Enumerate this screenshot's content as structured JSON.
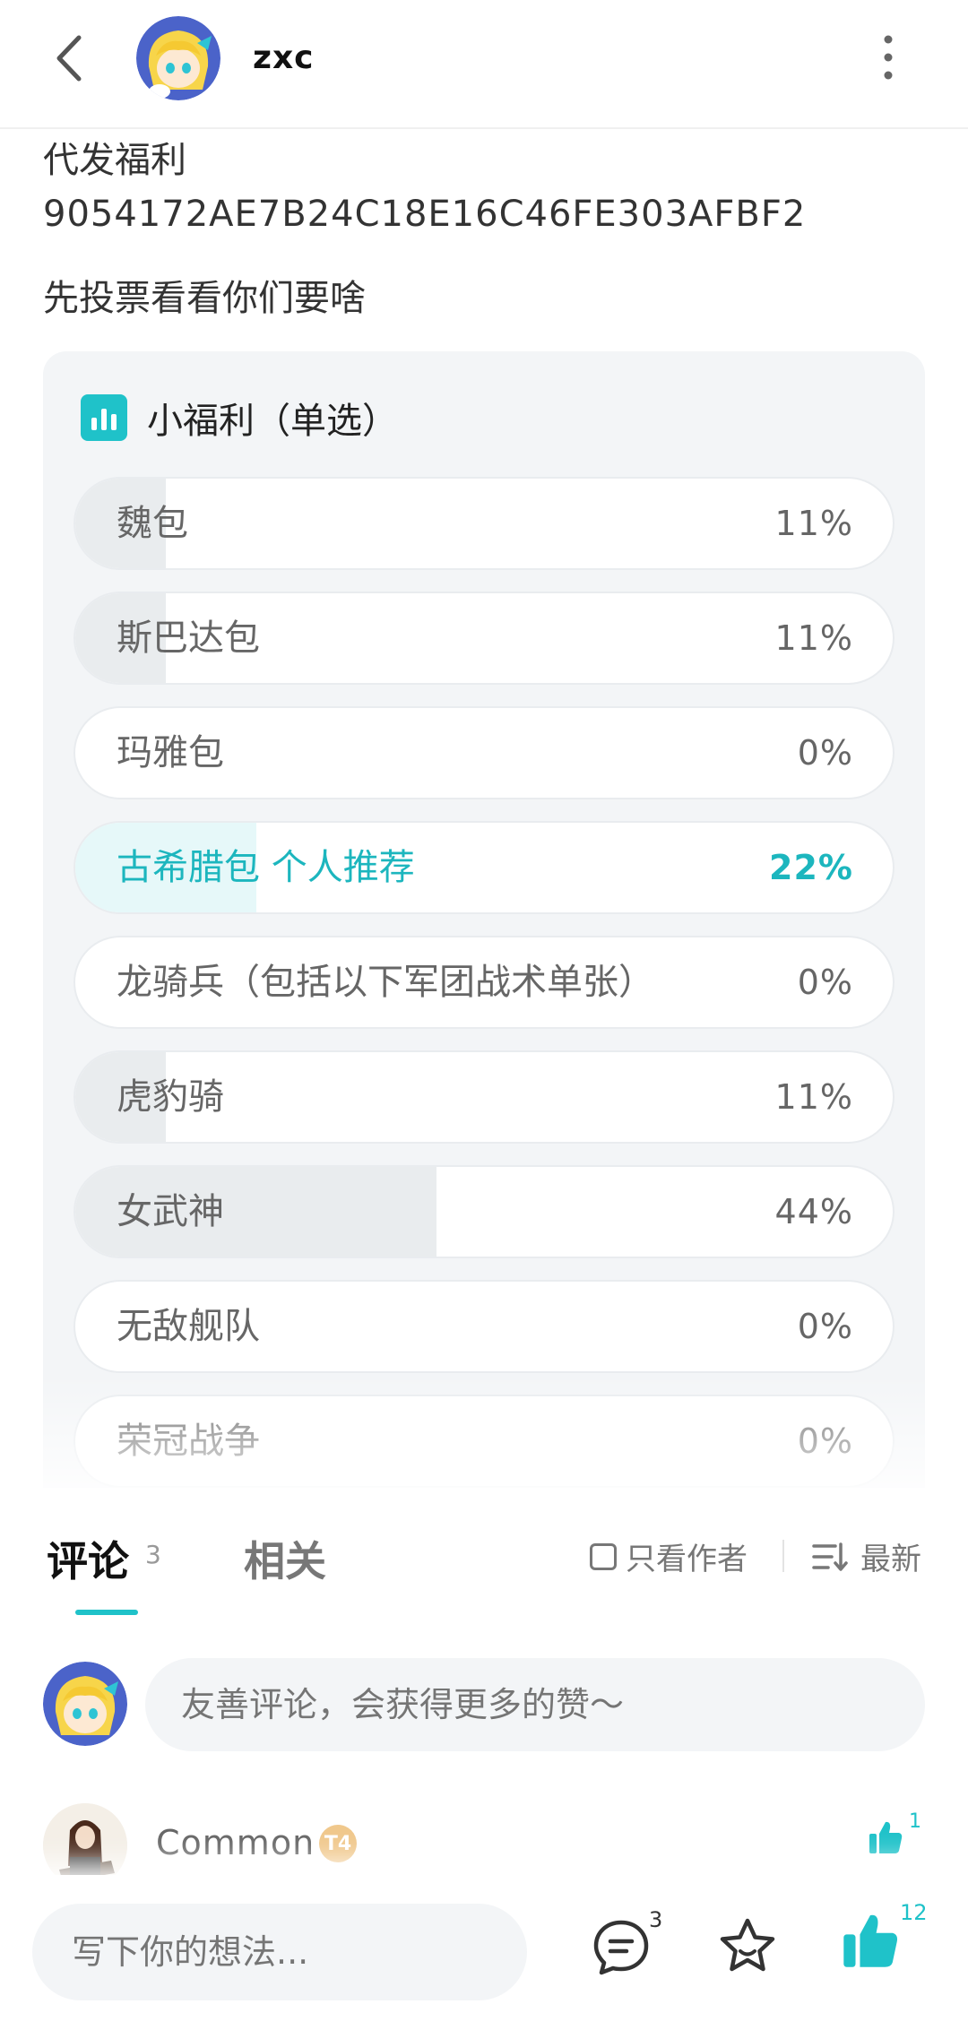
{
  "header": {
    "username": "zxc",
    "back_icon": "chevron-left-icon",
    "more_icon": "vertical-dots-icon"
  },
  "post": {
    "lines": [
      "代发福利",
      "9054172AE7B24C18E16C46FE303AFBF2",
      "先投票看看你们要啥"
    ]
  },
  "poll": {
    "title": "小福利（单选）",
    "accent_color": "#1fc2c9",
    "options": [
      {
        "label": "魏包",
        "percent": "11%",
        "fraction": 0.11,
        "selected": false
      },
      {
        "label": "斯巴达包",
        "percent": "11%",
        "fraction": 0.11,
        "selected": false
      },
      {
        "label": "玛雅包",
        "percent": "0%",
        "fraction": 0.0,
        "selected": false
      },
      {
        "label": "古希腊包 个人推荐",
        "percent": "22%",
        "fraction": 0.22,
        "selected": true
      },
      {
        "label": "龙骑兵（包括以下军团战术单张）",
        "percent": "0%",
        "fraction": 0.0,
        "selected": false
      },
      {
        "label": "虎豹骑",
        "percent": "11%",
        "fraction": 0.11,
        "selected": false
      },
      {
        "label": "女武神",
        "percent": "44%",
        "fraction": 0.44,
        "selected": false
      },
      {
        "label": "无敌舰队",
        "percent": "0%",
        "fraction": 0.0,
        "selected": false
      },
      {
        "label": "荣冠战争",
        "percent": "0%",
        "fraction": 0.0,
        "selected": false
      }
    ]
  },
  "comments_section": {
    "tab_comments": "评论",
    "comments_count": "3",
    "tab_related": "相关",
    "author_only": "只看作者",
    "sort_label": "最新",
    "input_placeholder": "友善评论，会获得更多的赞～"
  },
  "first_comment": {
    "name": "Common",
    "badge": "T4",
    "likes": "1"
  },
  "bottom_bar": {
    "input_placeholder": "写下你的想法...",
    "comment_count": "3",
    "like_count": "12"
  }
}
